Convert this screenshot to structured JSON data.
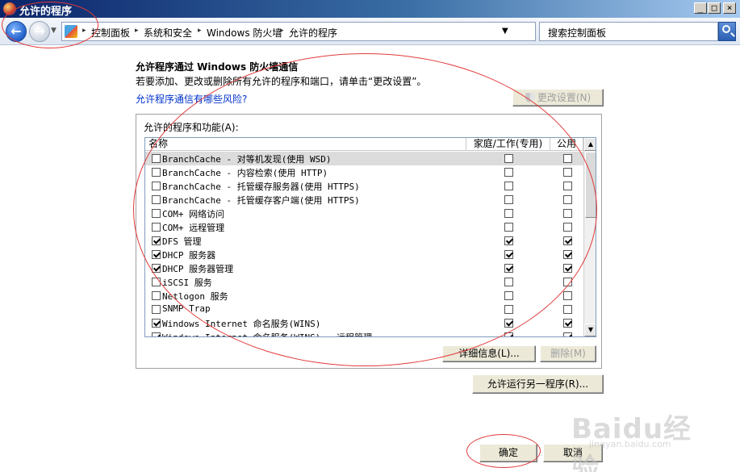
{
  "window": {
    "title": "允许的程序",
    "min": "_",
    "max": "□",
    "close": "×"
  },
  "nav": {
    "back": "←",
    "forward": "→",
    "drop": "▼",
    "crumbs": [
      "控制面板",
      "系统和安全",
      "Windows 防火墙",
      "允许的程序"
    ],
    "sep": "▸",
    "address_dropdown": "▼",
    "refresh": "↻",
    "search_placeholder": "搜索控制面板"
  },
  "main": {
    "heading": "允许程序通过 Windows 防火墙通信",
    "subtext": "若要添加、更改或删除所有允许的程序和端口，请单击“更改设置”。",
    "risk_link": "允许程序通信有哪些风险?",
    "change_settings": "更改设置(N)",
    "group_title": "允许的程序和功能(A):",
    "columns": {
      "name": "名称",
      "home": "家庭/工作(专用)",
      "public": "公用"
    },
    "rows": [
      {
        "name": "BranchCache - 对等机发现(使用 WSD)",
        "enabled": false,
        "home": false,
        "public": false
      },
      {
        "name": "BranchCache - 内容检索(使用 HTTP)",
        "enabled": false,
        "home": false,
        "public": false
      },
      {
        "name": "BranchCache - 托管缓存服务器(使用 HTTPS)",
        "enabled": false,
        "home": false,
        "public": false
      },
      {
        "name": "BranchCache - 托管缓存客户端(使用 HTTPS)",
        "enabled": false,
        "home": false,
        "public": false
      },
      {
        "name": "COM+ 网络访问",
        "enabled": false,
        "home": false,
        "public": false
      },
      {
        "name": "COM+ 远程管理",
        "enabled": false,
        "home": false,
        "public": false
      },
      {
        "name": "DFS 管理",
        "enabled": true,
        "home": true,
        "public": true
      },
      {
        "name": "DHCP 服务器",
        "enabled": true,
        "home": true,
        "public": true
      },
      {
        "name": "DHCP 服务器管理",
        "enabled": true,
        "home": true,
        "public": true
      },
      {
        "name": "iSCSI 服务",
        "enabled": false,
        "home": false,
        "public": false
      },
      {
        "name": "Netlogon 服务",
        "enabled": false,
        "home": false,
        "public": false
      },
      {
        "name": "SNMP Trap",
        "enabled": false,
        "home": false,
        "public": false
      },
      {
        "name": "Windows Internet 命名服务(WINS)",
        "enabled": true,
        "home": true,
        "public": true
      },
      {
        "name": "Windows Internet 命名服务(WINS) - 远程管理",
        "enabled": true,
        "home": true,
        "public": true
      }
    ],
    "details_button": "详细信息(L)...",
    "remove_button": "删除(M)",
    "allow_another": "允许运行另一程序(R)...",
    "ok": "确定",
    "cancel": "取消"
  },
  "watermark": {
    "text": "Baidu经验",
    "sub": "jingyan.baidu.com"
  },
  "colors": {
    "titlebar": "#0a246a",
    "link": "#0033cc",
    "annotation": "#e23a3a"
  }
}
